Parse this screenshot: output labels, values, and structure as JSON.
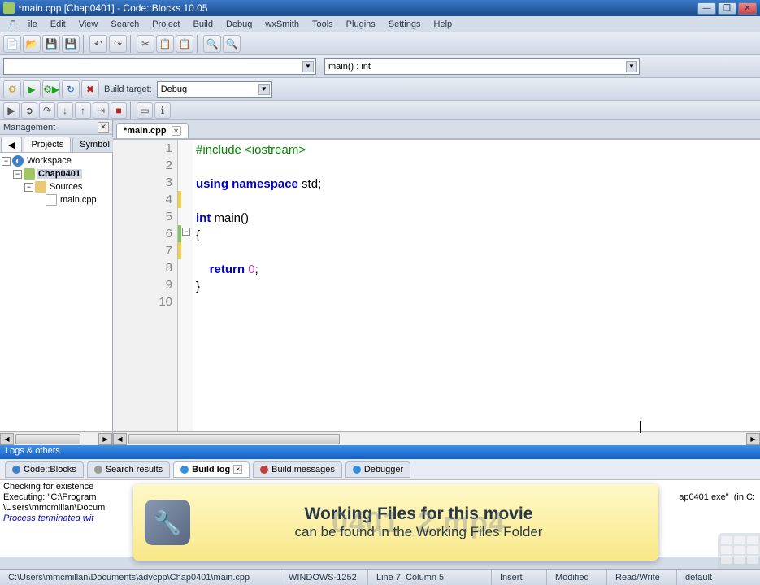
{
  "window": {
    "title": "*main.cpp [Chap0401] - Code::Blocks 10.05"
  },
  "menu": {
    "file": "File",
    "edit": "Edit",
    "view": "View",
    "search": "Search",
    "project": "Project",
    "build": "Build",
    "debug": "Debug",
    "wxsmith": "wxSmith",
    "tools": "Tools",
    "plugins": "Plugins",
    "settings": "Settings",
    "help": "Help"
  },
  "function_combo": "main() : int",
  "build_target_label": "Build target:",
  "build_target_value": "Debug",
  "management": {
    "title": "Management",
    "tabs": {
      "projects": "Projects",
      "symbol": "Symbol"
    },
    "tree": {
      "workspace": "Workspace",
      "project": "Chap0401",
      "folder": "Sources",
      "file": "main.cpp"
    }
  },
  "editor": {
    "tab_label": "*main.cpp",
    "lines": {
      "l1_include": "#include ",
      "l1_header": "<iostream>",
      "l3_using": "using",
      "l3_namespace": "namespace",
      "l3_std": " std;",
      "l5_int": "int",
      "l5_main": " main()",
      "l6": "{",
      "l7": "",
      "l8_return": "return",
      "l8_zero": "0",
      "l8_semi": ";",
      "l9": "}",
      "l10": ""
    },
    "line_numbers": [
      "1",
      "2",
      "3",
      "4",
      "5",
      "6",
      "7",
      "8",
      "9",
      "10"
    ]
  },
  "logs": {
    "header": "Logs & others",
    "tabs": {
      "codeblocks": "Code::Blocks",
      "search": "Search results",
      "buildlog": "Build log",
      "buildmsg": "Build messages",
      "debugger": "Debugger"
    },
    "content_l1": "Checking for existence",
    "content_l2": "Executing: \"C:\\Program",
    "content_l3": "\\Users\\mmcmillan\\Docum",
    "content_l4": "Process terminated wit",
    "content_right": "ap0401.exe\"  (in C:"
  },
  "overlay": {
    "line1": "Working Files for this movie",
    "line2": "can be found in the Working Files Folder",
    "watermark": "0401_2.mp4"
  },
  "status": {
    "path": "C:\\Users\\mmcmillan\\Documents\\advcpp\\Chap0401\\main.cpp",
    "encoding": "WINDOWS-1252",
    "position": "Line 7, Column 5",
    "insert": "Insert",
    "modified": "Modified",
    "readwrite": "Read/Write",
    "lang": "default"
  }
}
